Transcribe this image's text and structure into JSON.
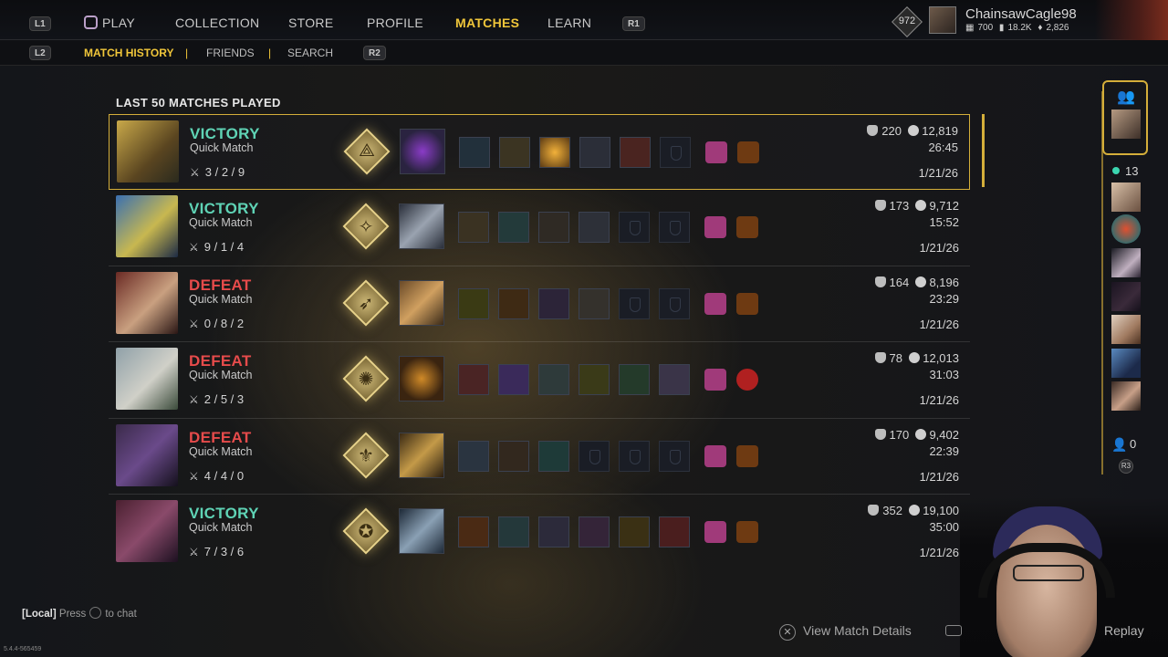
{
  "nav": {
    "left_bumper": "L1",
    "right_bumper": "R1",
    "items": [
      "PLAY",
      "COLLECTION",
      "STORE",
      "PROFILE",
      "MATCHES",
      "LEARN"
    ]
  },
  "subnav": {
    "left_trigger": "L2",
    "right_trigger": "R2",
    "items": [
      "MATCH HISTORY",
      "FRIENDS",
      "SEARCH"
    ],
    "separators": [
      "|",
      "|"
    ]
  },
  "profile": {
    "rank": "972",
    "username": "ChainsawCagle98",
    "currency_1": "700",
    "currency_2": "18.2K",
    "currency_3": "2,826"
  },
  "section_title": "LAST 50 MATCHES PLAYED",
  "matches": [
    {
      "outcome": "VICTORY",
      "mode": "Quick Match",
      "kda": "3 / 2 / 9",
      "stat_a": "220",
      "stat_b": "12,819",
      "duration": "26:45",
      "date": "1/21/26"
    },
    {
      "outcome": "VICTORY",
      "mode": "Quick Match",
      "kda": "9 / 1 / 4",
      "stat_a": "173",
      "stat_b": "9,712",
      "duration": "15:52",
      "date": "1/21/26"
    },
    {
      "outcome": "DEFEAT",
      "mode": "Quick Match",
      "kda": "0 / 8 / 2",
      "stat_a": "164",
      "stat_b": "8,196",
      "duration": "23:29",
      "date": "1/21/26"
    },
    {
      "outcome": "DEFEAT",
      "mode": "Quick Match",
      "kda": "2 / 5 / 3",
      "stat_a": "78",
      "stat_b": "12,013",
      "duration": "31:03",
      "date": "1/21/26"
    },
    {
      "outcome": "DEFEAT",
      "mode": "Quick Match",
      "kda": "4 / 4 / 0",
      "stat_a": "170",
      "stat_b": "9,402",
      "duration": "22:39",
      "date": "1/21/26"
    },
    {
      "outcome": "VICTORY",
      "mode": "Quick Match",
      "kda": "7 / 3 / 6",
      "stat_a": "352",
      "stat_b": "19,100",
      "duration": "35:00",
      "date": "1/21/26"
    }
  ],
  "party": {
    "online_count": "13",
    "invite_count": "0",
    "stick_hint": "R3"
  },
  "chat": {
    "channel": "[Local]",
    "press": "Press",
    "to_chat": "to chat"
  },
  "version": "5.4.4-565459",
  "footer": {
    "view_details": "View Match Details",
    "replay": "Replay"
  },
  "colors": {
    "accent": "#f0c63a",
    "victory": "#5fd3b5",
    "defeat": "#e64b4b",
    "selection_border": "#d4ae3a"
  }
}
